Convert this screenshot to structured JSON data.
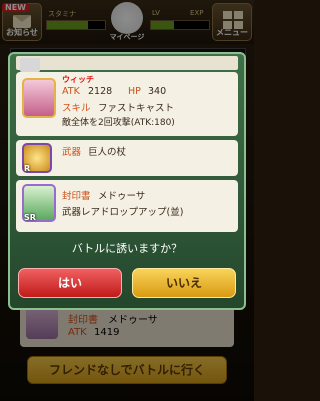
{
  "header": {
    "notice_badge": "NEW",
    "notice_label": "お知らせ",
    "mypage_label": "マイページ",
    "menu_label": "メニュー",
    "stamina_label": "スタミナ",
    "lv_label": "LV",
    "exp_label": "EXP"
  },
  "modal": {
    "monster": {
      "badge": "ウィッチ",
      "atk_label": "ATK",
      "atk": "2128",
      "hp_label": "HP",
      "hp": "340",
      "skill_label": "スキル",
      "skill_name": "ファストキャスト",
      "skill_desc": "敵全体を2回攻撃(ATK:180)"
    },
    "weapon": {
      "label": "武器",
      "name": "巨人の杖",
      "rarity": "R"
    },
    "seal": {
      "label": "封印書",
      "name": "メドゥーサ",
      "desc": "武器レアドロップアップ(並)",
      "rarity": "SR"
    },
    "question": "バトルに誘いますか？",
    "yes": "はい",
    "no": "いいえ"
  },
  "background_card": {
    "label": "封印書",
    "name": "メドゥーサ",
    "atk_label": "ATK",
    "atk": "1419"
  },
  "friend_button": "フレンドなしでバトルに行く"
}
